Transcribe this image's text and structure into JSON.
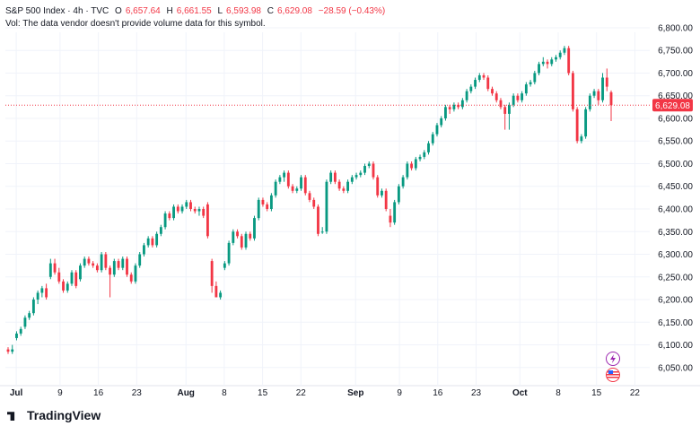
{
  "header": {
    "symbol": "S&P 500 Index · 4h · TVC",
    "o_label": "O",
    "o_value": "6,657.64",
    "h_label": "H",
    "h_value": "6,661.55",
    "l_label": "L",
    "l_value": "6,593.98",
    "c_label": "C",
    "c_value": "6,629.08",
    "change": "−28.59 (−0.43%)",
    "volume_note": "Vol: The data vendor doesn't provide volume data for this symbol."
  },
  "brand": {
    "name": "TradingView"
  },
  "colors": {
    "up": "#089981",
    "down": "#f23645",
    "grid": "#f0f3fa",
    "price_line": "#f23645",
    "axis_text": "#131722"
  },
  "chart_data": {
    "type": "candlestick",
    "ylim": [
      6010,
      6790
    ],
    "y_ticks": [
      "6,800.00",
      "6,750.00",
      "6,700.00",
      "6,650.00",
      "6,600.00",
      "6,550.00",
      "6,500.00",
      "6,450.00",
      "6,400.00",
      "6,350.00",
      "6,300.00",
      "6,250.00",
      "6,200.00",
      "6,150.00",
      "6,100.00",
      "6,050.00"
    ],
    "y_tick_values": [
      6800,
      6750,
      6700,
      6650,
      6600,
      6550,
      6500,
      6450,
      6400,
      6350,
      6300,
      6250,
      6200,
      6150,
      6100,
      6050
    ],
    "x_ticks": [
      "Jul",
      "9",
      "16",
      "23",
      "Aug",
      "8",
      "15",
      "22",
      "Sep",
      "9",
      "16",
      "23",
      "Oct",
      "8",
      "15",
      "22"
    ],
    "x_tick_dates": [
      "2025-07-01",
      "2025-07-09",
      "2025-07-16",
      "2025-07-23",
      "2025-08-01",
      "2025-08-08",
      "2025-08-15",
      "2025-08-22",
      "2025-09-01",
      "2025-09-09",
      "2025-09-16",
      "2025-09-23",
      "2025-10-01",
      "2025-10-08",
      "2025-10-15",
      "2025-10-22"
    ],
    "x_bold": [
      0,
      4,
      8,
      12
    ],
    "last_price": 6629.08,
    "last_price_label": "6,629.08",
    "closes": [
      6085,
      6090,
      6095,
      6130,
      6160,
      6170,
      6200,
      6215,
      6225,
      6205,
      6280,
      6260,
      6240,
      6220,
      6235,
      6260,
      6230,
      6275,
      6290,
      6280,
      6275,
      6265,
      6300,
      6270,
      6255,
      6285,
      6270,
      6290,
      6255,
      6240,
      6275,
      6300,
      6320,
      6335,
      6320,
      6345,
      6360,
      6390,
      6380,
      6405,
      6395,
      6405,
      6415,
      6400,
      6395,
      6400,
      6385,
      6340,
      6230,
      6205,
      6215,
      6280,
      6325,
      6350,
      6340,
      6315,
      6345,
      6335,
      6380,
      6420,
      6410,
      6400,
      6430,
      6460,
      6470,
      6480,
      6450,
      6440,
      6445,
      6470,
      6435,
      6420,
      6405,
      6345,
      6350,
      6460,
      6480,
      6460,
      6445,
      6440,
      6460,
      6470,
      6475,
      6480,
      6495,
      6500,
      6470,
      6430,
      6440,
      6400,
      6370,
      6415,
      6450,
      6470,
      6500,
      6490,
      6510,
      6515,
      6525,
      6545,
      6565,
      6585,
      6600,
      6625,
      6620,
      6630,
      6625,
      6640,
      6660,
      6670,
      6685,
      6695,
      6690,
      6665,
      6655,
      6640,
      6625,
      6610,
      6630,
      6650,
      6640,
      6655,
      6675,
      6680,
      6700,
      6720,
      6725,
      6720,
      6730,
      6735,
      6745,
      6755,
      6700,
      6620,
      6550,
      6560,
      6620,
      6650,
      6660,
      6640,
      6690,
      6670,
      6629
    ],
    "bars": [
      [
        6090,
        6095,
        6080,
        6085
      ],
      [
        6085,
        6100,
        6080,
        6090
      ],
      [
        6115,
        6130,
        6110,
        6125
      ],
      [
        6125,
        6140,
        6120,
        6135
      ],
      [
        6140,
        6165,
        6135,
        6160
      ],
      [
        6160,
        6175,
        6155,
        6170
      ],
      [
        6170,
        6205,
        6165,
        6200
      ],
      [
        6200,
        6220,
        6190,
        6215
      ],
      [
        6215,
        6230,
        6205,
        6225
      ],
      [
        6225,
        6235,
        6200,
        6205
      ],
      [
        6250,
        6290,
        6245,
        6280
      ],
      [
        6280,
        6290,
        6255,
        6260
      ],
      [
        6260,
        6270,
        6235,
        6240
      ],
      [
        6240,
        6245,
        6215,
        6220
      ],
      [
        6220,
        6240,
        6215,
        6235
      ],
      [
        6235,
        6265,
        6230,
        6260
      ],
      [
        6260,
        6265,
        6225,
        6230
      ],
      [
        6245,
        6280,
        6240,
        6275
      ],
      [
        6275,
        6295,
        6270,
        6290
      ],
      [
        6290,
        6295,
        6275,
        6280
      ],
      [
        6280,
        6285,
        6270,
        6275
      ],
      [
        6275,
        6280,
        6260,
        6265
      ],
      [
        6265,
        6305,
        6260,
        6300
      ],
      [
        6300,
        6305,
        6265,
        6270
      ],
      [
        6270,
        6275,
        6205,
        6255
      ],
      [
        6255,
        6290,
        6250,
        6285
      ],
      [
        6285,
        6290,
        6265,
        6270
      ],
      [
        6270,
        6295,
        6265,
        6290
      ],
      [
        6290,
        6295,
        6250,
        6255
      ],
      [
        6255,
        6260,
        6235,
        6240
      ],
      [
        6240,
        6280,
        6235,
        6275
      ],
      [
        6275,
        6305,
        6270,
        6300
      ],
      [
        6300,
        6325,
        6295,
        6320
      ],
      [
        6320,
        6340,
        6315,
        6335
      ],
      [
        6335,
        6340,
        6315,
        6320
      ],
      [
        6320,
        6350,
        6315,
        6345
      ],
      [
        6345,
        6365,
        6340,
        6360
      ],
      [
        6360,
        6395,
        6355,
        6390
      ],
      [
        6390,
        6395,
        6375,
        6380
      ],
      [
        6380,
        6410,
        6375,
        6405
      ],
      [
        6405,
        6410,
        6390,
        6395
      ],
      [
        6395,
        6410,
        6390,
        6405
      ],
      [
        6405,
        6420,
        6400,
        6415
      ],
      [
        6415,
        6420,
        6395,
        6400
      ],
      [
        6400,
        6405,
        6390,
        6395
      ],
      [
        6395,
        6405,
        6385,
        6400
      ],
      [
        6400,
        6405,
        6380,
        6385
      ],
      [
        6410,
        6415,
        6335,
        6340
      ],
      [
        6285,
        6290,
        6215,
        6230
      ],
      [
        6230,
        6240,
        6205,
        6205
      ],
      [
        6205,
        6220,
        6200,
        6215
      ],
      [
        6270,
        6285,
        6265,
        6280
      ],
      [
        6280,
        6330,
        6275,
        6325
      ],
      [
        6325,
        6355,
        6320,
        6350
      ],
      [
        6350,
        6355,
        6335,
        6340
      ],
      [
        6340,
        6345,
        6310,
        6315
      ],
      [
        6315,
        6350,
        6310,
        6345
      ],
      [
        6345,
        6350,
        6330,
        6335
      ],
      [
        6335,
        6385,
        6330,
        6380
      ],
      [
        6380,
        6425,
        6375,
        6420
      ],
      [
        6420,
        6425,
        6405,
        6410
      ],
      [
        6410,
        6415,
        6395,
        6400
      ],
      [
        6400,
        6435,
        6395,
        6430
      ],
      [
        6430,
        6465,
        6425,
        6460
      ],
      [
        6460,
        6475,
        6455,
        6470
      ],
      [
        6470,
        6485,
        6460,
        6480
      ],
      [
        6480,
        6485,
        6445,
        6450
      ],
      [
        6450,
        6455,
        6435,
        6440
      ],
      [
        6440,
        6450,
        6435,
        6445
      ],
      [
        6445,
        6475,
        6440,
        6470
      ],
      [
        6470,
        6475,
        6430,
        6435
      ],
      [
        6435,
        6440,
        6415,
        6420
      ],
      [
        6420,
        6425,
        6400,
        6405
      ],
      [
        6405,
        6410,
        6340,
        6345
      ],
      [
        6350,
        6360,
        6345,
        6350
      ],
      [
        6350,
        6465,
        6345,
        6460
      ],
      [
        6460,
        6485,
        6455,
        6480
      ],
      [
        6480,
        6485,
        6455,
        6460
      ],
      [
        6460,
        6465,
        6440,
        6445
      ],
      [
        6445,
        6450,
        6435,
        6440
      ],
      [
        6440,
        6465,
        6435,
        6460
      ],
      [
        6460,
        6475,
        6455,
        6470
      ],
      [
        6470,
        6480,
        6465,
        6475
      ],
      [
        6475,
        6485,
        6470,
        6480
      ],
      [
        6480,
        6500,
        6475,
        6495
      ],
      [
        6495,
        6505,
        6490,
        6500
      ],
      [
        6500,
        6505,
        6465,
        6470
      ],
      [
        6470,
        6475,
        6425,
        6430
      ],
      [
        6430,
        6445,
        6425,
        6440
      ],
      [
        6440,
        6445,
        6395,
        6400
      ],
      [
        6385,
        6400,
        6360,
        6370
      ],
      [
        6370,
        6420,
        6365,
        6415
      ],
      [
        6415,
        6455,
        6410,
        6450
      ],
      [
        6450,
        6475,
        6445,
        6470
      ],
      [
        6470,
        6505,
        6465,
        6500
      ],
      [
        6500,
        6505,
        6485,
        6490
      ],
      [
        6490,
        6515,
        6485,
        6510
      ],
      [
        6510,
        6520,
        6505,
        6515
      ],
      [
        6515,
        6530,
        6510,
        6525
      ],
      [
        6525,
        6550,
        6520,
        6545
      ],
      [
        6545,
        6570,
        6540,
        6565
      ],
      [
        6565,
        6590,
        6560,
        6585
      ],
      [
        6585,
        6605,
        6580,
        6600
      ],
      [
        6600,
        6630,
        6595,
        6625
      ],
      [
        6625,
        6630,
        6610,
        6620
      ],
      [
        6620,
        6635,
        6615,
        6630
      ],
      [
        6630,
        6635,
        6620,
        6625
      ],
      [
        6625,
        6645,
        6620,
        6640
      ],
      [
        6640,
        6665,
        6635,
        6660
      ],
      [
        6660,
        6675,
        6655,
        6670
      ],
      [
        6670,
        6690,
        6665,
        6685
      ],
      [
        6685,
        6700,
        6680,
        6695
      ],
      [
        6695,
        6700,
        6685,
        6690
      ],
      [
        6690,
        6695,
        6660,
        6665
      ],
      [
        6665,
        6670,
        6650,
        6655
      ],
      [
        6655,
        6660,
        6635,
        6640
      ],
      [
        6640,
        6645,
        6620,
        6625
      ],
      [
        6625,
        6630,
        6575,
        6610
      ],
      [
        6610,
        6635,
        6575,
        6630
      ],
      [
        6630,
        6655,
        6625,
        6650
      ],
      [
        6650,
        6655,
        6635,
        6640
      ],
      [
        6640,
        6660,
        6635,
        6655
      ],
      [
        6655,
        6680,
        6650,
        6675
      ],
      [
        6675,
        6685,
        6670,
        6680
      ],
      [
        6680,
        6705,
        6675,
        6700
      ],
      [
        6700,
        6725,
        6695,
        6720
      ],
      [
        6720,
        6735,
        6715,
        6725
      ],
      [
        6725,
        6730,
        6710,
        6720
      ],
      [
        6720,
        6735,
        6715,
        6730
      ],
      [
        6730,
        6740,
        6725,
        6735
      ],
      [
        6735,
        6750,
        6730,
        6745
      ],
      [
        6745,
        6760,
        6740,
        6755
      ],
      [
        6755,
        6760,
        6695,
        6700
      ],
      [
        6700,
        6705,
        6615,
        6620
      ],
      [
        6620,
        6625,
        6545,
        6550
      ],
      [
        6550,
        6565,
        6545,
        6560
      ],
      [
        6560,
        6625,
        6555,
        6620
      ],
      [
        6620,
        6655,
        6615,
        6650
      ],
      [
        6650,
        6665,
        6645,
        6660
      ],
      [
        6660,
        6665,
        6630,
        6640
      ],
      [
        6640,
        6700,
        6635,
        6690
      ],
      [
        6690,
        6710,
        6660,
        6670
      ],
      [
        6657.64,
        6661.55,
        6593.98,
        6629.08
      ]
    ]
  }
}
